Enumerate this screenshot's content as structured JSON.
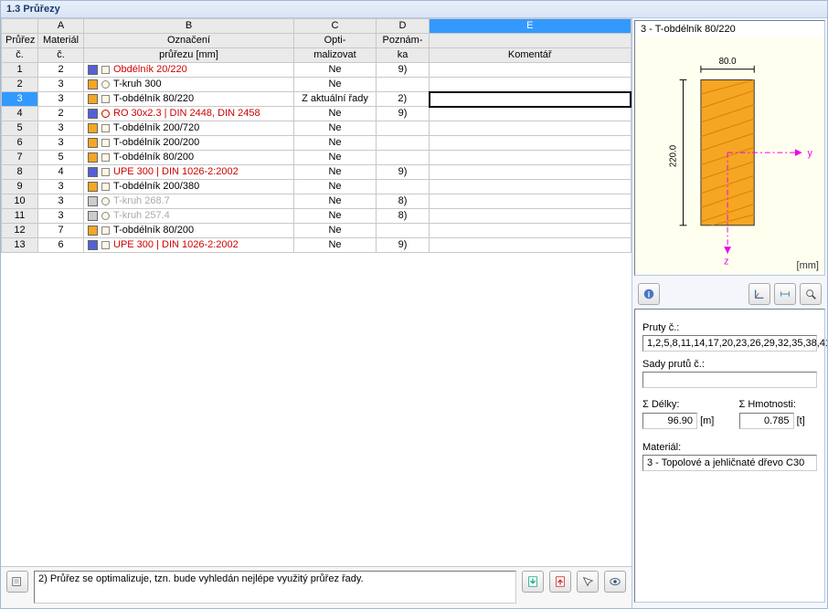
{
  "title": "1.3 Průřezy",
  "columns": {
    "letters": [
      "",
      "A",
      "B",
      "C",
      "D",
      "E"
    ],
    "headers": {
      "row1": [
        "Průřez",
        "Materiál",
        "Označení",
        "Opti-",
        "Poznám-",
        ""
      ],
      "row2": [
        "č.",
        "č.",
        "průřezu [mm]",
        "malizovat",
        "ka",
        "Komentář"
      ]
    }
  },
  "rows": [
    {
      "n": "1",
      "mat": "2",
      "sw": "sw-blue",
      "ico": "sq",
      "label": "Obdélník 20/220",
      "cls": "txt-red",
      "opt": "Ne",
      "note": "9)",
      "cmt": ""
    },
    {
      "n": "2",
      "mat": "3",
      "sw": "sw-orange",
      "ico": "o",
      "label": "T-kruh 300",
      "cls": "txt-blk",
      "opt": "Ne",
      "note": "",
      "cmt": ""
    },
    {
      "n": "3",
      "mat": "3",
      "sw": "sw-orange",
      "ico": "sq",
      "label": "T-obdélník 80/220",
      "cls": "txt-blk",
      "opt": "Z aktuální řady",
      "note": "2)",
      "cmt": "",
      "selected": true
    },
    {
      "n": "4",
      "mat": "2",
      "sw": "sw-blue",
      "ico": "ored",
      "label": "RO 30x2.3 | DIN 2448, DIN 2458",
      "cls": "txt-red",
      "opt": "Ne",
      "note": "9)",
      "cmt": ""
    },
    {
      "n": "5",
      "mat": "3",
      "sw": "sw-orange",
      "ico": "sq",
      "label": "T-obdélník 200/720",
      "cls": "txt-blk",
      "opt": "Ne",
      "note": "",
      "cmt": ""
    },
    {
      "n": "6",
      "mat": "3",
      "sw": "sw-orange",
      "ico": "sq",
      "label": "T-obdélník 200/200",
      "cls": "txt-blk",
      "opt": "Ne",
      "note": "",
      "cmt": ""
    },
    {
      "n": "7",
      "mat": "5",
      "sw": "sw-orange",
      "ico": "sq",
      "label": "T-obdélník 80/200",
      "cls": "txt-blk",
      "opt": "Ne",
      "note": "",
      "cmt": ""
    },
    {
      "n": "8",
      "mat": "4",
      "sw": "sw-blue",
      "ico": "sq",
      "label": "UPE 300 | DIN 1026-2:2002",
      "cls": "txt-red",
      "opt": "Ne",
      "note": "9)",
      "cmt": ""
    },
    {
      "n": "9",
      "mat": "3",
      "sw": "sw-orange",
      "ico": "sq",
      "label": "T-obdélník 200/380",
      "cls": "txt-blk",
      "opt": "Ne",
      "note": "",
      "cmt": ""
    },
    {
      "n": "10",
      "mat": "3",
      "sw": "sw-greyd",
      "ico": "o",
      "label": "T-kruh 268.7",
      "cls": "txt-grey",
      "opt": "Ne",
      "note": "8)",
      "cmt": ""
    },
    {
      "n": "11",
      "mat": "3",
      "sw": "sw-greyd",
      "ico": "o",
      "label": "T-kruh 257.4",
      "cls": "txt-grey",
      "opt": "Ne",
      "note": "8)",
      "cmt": ""
    },
    {
      "n": "12",
      "mat": "7",
      "sw": "sw-orange",
      "ico": "sq",
      "label": "T-obdélník 80/200",
      "cls": "txt-blk",
      "opt": "Ne",
      "note": "",
      "cmt": ""
    },
    {
      "n": "13",
      "mat": "6",
      "sw": "sw-blue",
      "ico": "sq",
      "label": "UPE 300 | DIN 1026-2:2002",
      "cls": "txt-red",
      "opt": "Ne",
      "note": "9)",
      "cmt": ""
    }
  ],
  "footer_note": "2) Průřez se optimalizuje, tzn. bude vyhledán nejlépe využitý průřez řady.",
  "preview": {
    "title": "3 - T-obdélník 80/220",
    "width_label": "80.0",
    "height_label": "220.0",
    "axis_y": "y",
    "axis_z": "z",
    "unit": "[mm]"
  },
  "info": {
    "members_label": "Pruty č.:",
    "members_value": "1,2,5,8,11,14,17,20,23,26,29,32,35,38,41",
    "sets_label": "Sady prutů č.:",
    "sets_value": "",
    "length_label": "Σ Délky:",
    "length_value": "96.90",
    "length_unit": "[m]",
    "mass_label": "Σ Hmotnosti:",
    "mass_value": "0.785",
    "mass_unit": "[t]",
    "material_label": "Materiál:",
    "material_value": "3 - Topolové a jehličnaté dřevo C30"
  }
}
